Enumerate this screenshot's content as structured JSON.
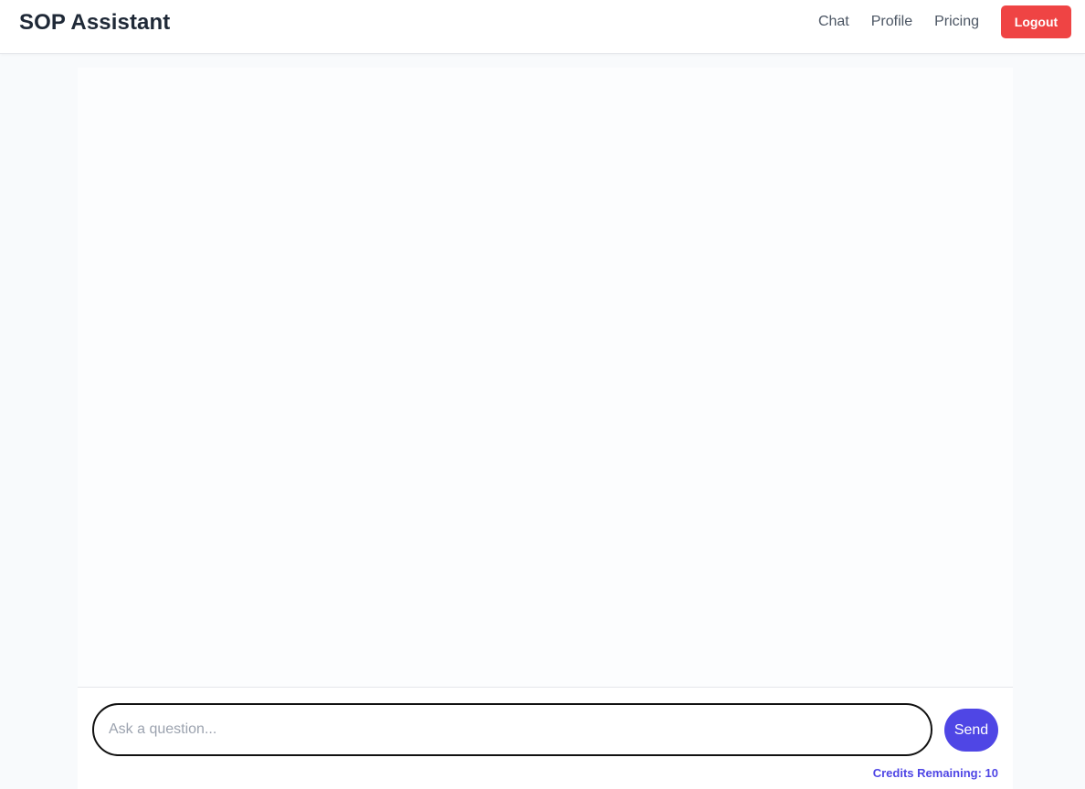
{
  "navbar": {
    "brand": "SOP Assistant",
    "links": [
      {
        "label": "Chat"
      },
      {
        "label": "Profile"
      },
      {
        "label": "Pricing"
      }
    ],
    "logout_label": "Logout"
  },
  "chat": {
    "input_placeholder": "Ask a question...",
    "input_value": "",
    "send_label": "Send",
    "credits_text": "Credits Remaining: 10"
  },
  "colors": {
    "accent": "#4f46e5",
    "danger": "#ef4444",
    "text_dark": "#1f2937",
    "page_bg": "#f8fafc"
  }
}
